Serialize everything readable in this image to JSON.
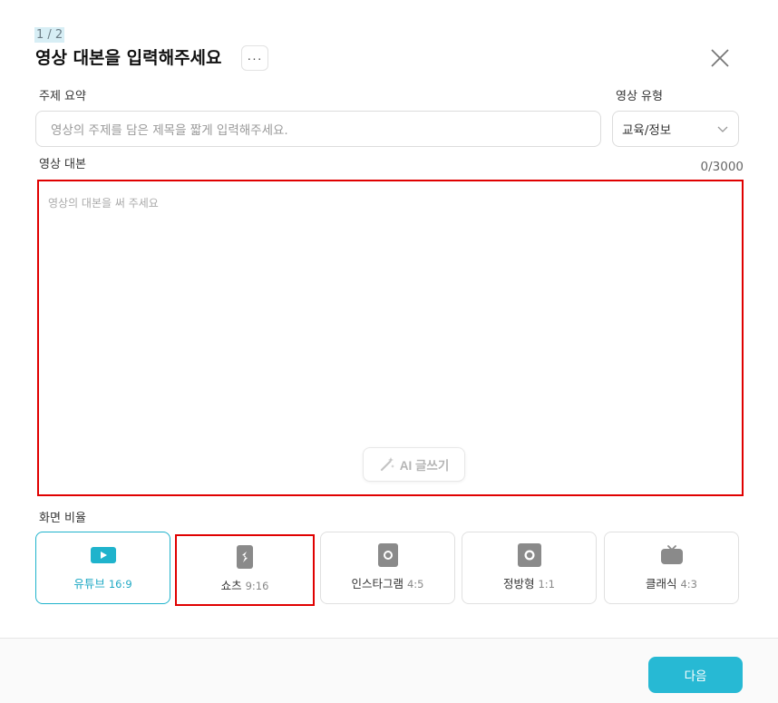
{
  "header": {
    "step": "1 / 2",
    "title": "영상 대본을 입력해주세요",
    "more_label": "···"
  },
  "topic": {
    "label": "주제 요약",
    "placeholder": "영상의 주제를 담은 제목을 짧게 입력해주세요."
  },
  "video_type": {
    "label": "영상 유형",
    "selected": "교육/정보"
  },
  "script": {
    "label": "영상 대본",
    "counter": "0/3000",
    "placeholder": "영상의 대본을 써 주세요",
    "ai_button": "AI 글쓰기"
  },
  "aspect": {
    "label": "화면 비율",
    "options": [
      {
        "name": "유튜브",
        "ratio": "16:9",
        "icon": "youtube-icon"
      },
      {
        "name": "쇼츠",
        "ratio": "9:16",
        "icon": "shorts-icon"
      },
      {
        "name": "인스타그램",
        "ratio": "4:5",
        "icon": "instagram-icon"
      },
      {
        "name": "정방형",
        "ratio": "1:1",
        "icon": "square-icon"
      },
      {
        "name": "클래식",
        "ratio": "4:3",
        "icon": "tv-icon"
      }
    ]
  },
  "footer": {
    "next_label": "다음"
  },
  "colors": {
    "accent": "#27b9d4",
    "highlight": "#e00000"
  }
}
